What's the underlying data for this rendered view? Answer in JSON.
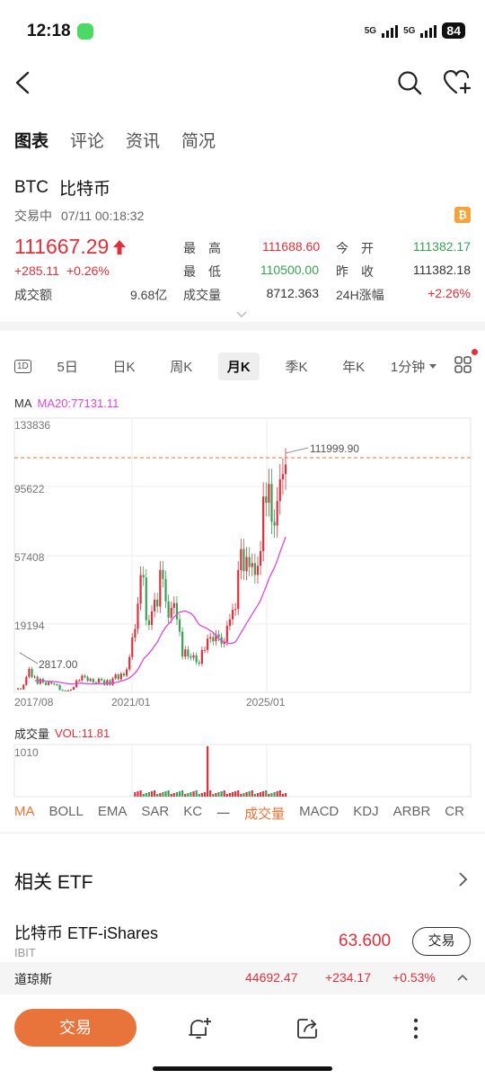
{
  "status_bar": {
    "time": "12:18",
    "signal_a": "5G",
    "signal_b": "5G",
    "battery": "84"
  },
  "header": {
    "icons": [
      "back-arrow-icon",
      "search-icon",
      "heart-plus-icon"
    ],
    "tabs": [
      {
        "label": "图表",
        "active": true
      },
      {
        "label": "评论",
        "active": false
      },
      {
        "label": "资讯",
        "active": false
      },
      {
        "label": "简况",
        "active": false
      }
    ]
  },
  "quote": {
    "symbol": "BTC",
    "name": "比特币",
    "status": "交易中",
    "datetime": "07/11 00:18:32",
    "badge_icon": "bitcoin-icon",
    "price": "111667.29",
    "change": "+285.11",
    "change_pct": "+0.26%",
    "turnover_label": "成交额",
    "turnover_value": "9.68亿",
    "stats": [
      {
        "label": "最　高",
        "value": "111688.60",
        "color": "red"
      },
      {
        "label": "今　开",
        "value": "111382.17",
        "color": "green"
      },
      {
        "label": "最　低",
        "value": "110500.00",
        "color": "green"
      },
      {
        "label": "昨　收",
        "value": "111382.18",
        "color": "dark"
      },
      {
        "label": "成交量",
        "value": "8712.363",
        "color": "dark"
      },
      {
        "label": "24H涨幅",
        "value": "+2.26%",
        "color": "red"
      }
    ]
  },
  "periods": {
    "items": [
      {
        "label": "1D",
        "active": false
      },
      {
        "label": "5日",
        "active": false
      },
      {
        "label": "日K",
        "active": false
      },
      {
        "label": "周K",
        "active": false
      },
      {
        "label": "月K",
        "active": true
      },
      {
        "label": "季K",
        "active": false
      },
      {
        "label": "年K",
        "active": false
      },
      {
        "label": "1分钟",
        "active": false
      }
    ],
    "grid_icon": "grid-icon"
  },
  "chart": {
    "ma_label": "MA",
    "ma20_label": "MA20:77131.11",
    "y_ticks": [
      "133836",
      "95622",
      "57408",
      "19194"
    ],
    "max_label": "111999.90",
    "min_label": "2817.00",
    "x_ticks": [
      "2017/08",
      "2021/01",
      "2025/01"
    ],
    "vol_label": "成交量",
    "vol_value": "VOL:11.81",
    "vol_tick": "1010"
  },
  "chart_data": {
    "type": "candlestick",
    "title": "",
    "x_start": "2017/08",
    "x_end": "2025/07",
    "ylim": [
      2817.0,
      133836
    ],
    "y_ticks": [
      19194,
      57408,
      95622,
      133836
    ],
    "highest_high": 111999.9,
    "lowest_low": 2817.0,
    "ma20_latest": 77131.11,
    "volume_latest": 11.81,
    "volume_tick": 1010,
    "monthly_close_approx": [
      4700,
      4300,
      6400,
      10200,
      14000,
      10200,
      10300,
      6900,
      9200,
      7500,
      6400,
      7700,
      7000,
      6600,
      6300,
      4000,
      3700,
      3500,
      3800,
      4100,
      5300,
      8500,
      8600,
      10800,
      10100,
      8300,
      9200,
      7600,
      7400,
      9300,
      8600,
      6400,
      8600,
      6400,
      9500,
      11300,
      9100,
      11800,
      10800,
      13800,
      19700,
      29000,
      33100,
      45200,
      58900,
      57700,
      37300,
      35000,
      41500,
      47100,
      43800,
      61300,
      57000,
      46300,
      38500,
      43200,
      45500,
      37700,
      31800,
      19900,
      23300,
      20000,
      19400,
      20500,
      17200,
      16500,
      23100,
      23100,
      28500,
      29200,
      27200,
      30500,
      29200,
      26000,
      27000,
      34600,
      37700,
      42300,
      42600,
      61200,
      71300,
      60700,
      67500,
      62700,
      64600,
      58900,
      63300,
      70300,
      96400,
      93400,
      102400,
      84300,
      82500,
      94200,
      104600,
      107100,
      111667.29
    ]
  },
  "indicators": {
    "items": [
      {
        "label": "MA",
        "active": true
      },
      {
        "label": "BOLL",
        "active": false
      },
      {
        "label": "EMA",
        "active": false
      },
      {
        "label": "SAR",
        "active": false
      },
      {
        "label": "KC",
        "active": false
      },
      {
        "label": "一",
        "active": false
      },
      {
        "label": "成交量",
        "active": true
      },
      {
        "label": "MACD",
        "active": false
      },
      {
        "label": "KDJ",
        "active": false
      },
      {
        "label": "ARBR",
        "active": false
      },
      {
        "label": "CR",
        "active": false
      }
    ]
  },
  "etf": {
    "title": "相关 ETF",
    "name": "比特币 ETF-iShares",
    "code": "IBIT",
    "price": "63.600",
    "trade_label": "交易"
  },
  "dow": {
    "name": "道琼斯",
    "value": "44692.47",
    "change": "+234.17",
    "pct": "+0.53%"
  },
  "bottom": {
    "trade_label": "交易",
    "icons": [
      "alert-plus-icon",
      "share-icon",
      "more-icon"
    ]
  },
  "colors": {
    "accent": "#e8743b",
    "up": "#e0303c",
    "down": "#3aa055",
    "ma": "#d84bd8"
  }
}
